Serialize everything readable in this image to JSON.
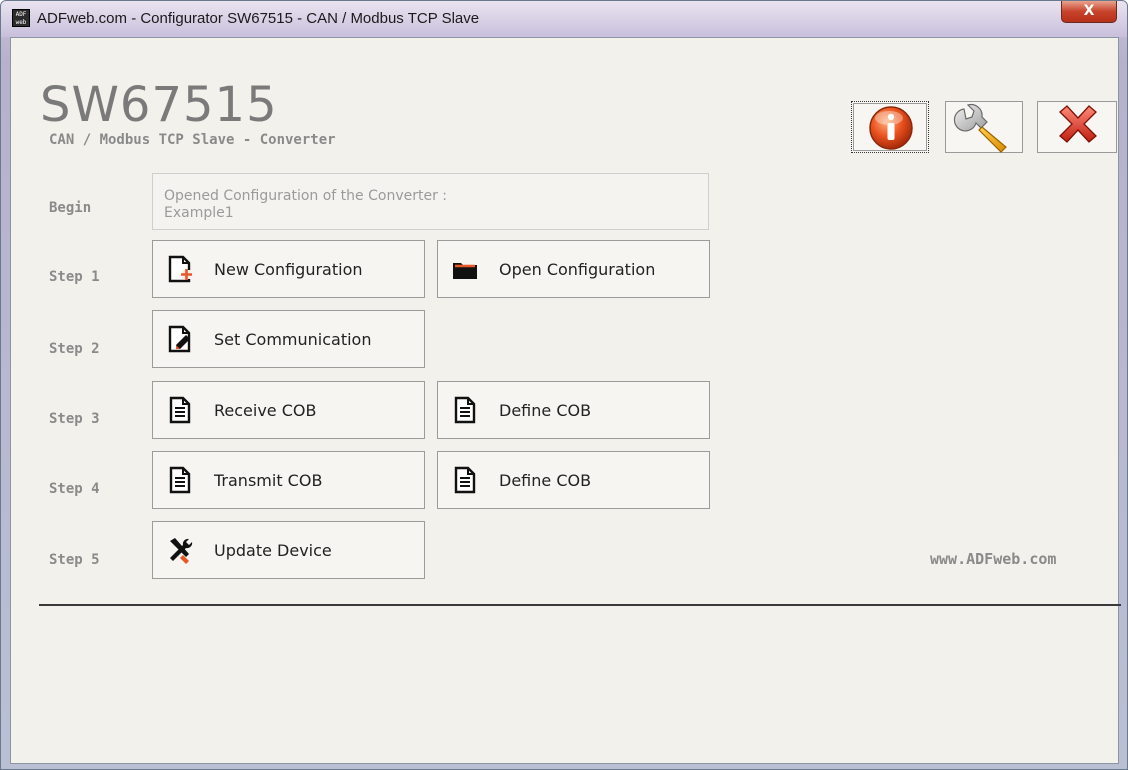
{
  "window": {
    "title": "ADFweb.com - Configurator SW67515 - CAN / Modbus TCP Slave",
    "close_label": "X",
    "app_icon_label": "ADF web"
  },
  "header": {
    "product_code": "SW67515",
    "product_subtitle": "CAN / Modbus TCP Slave - Converter"
  },
  "toolbar": {
    "info_icon": "info-icon",
    "settings_icon": "wrench-icon",
    "exit_icon": "close-x-icon"
  },
  "steps": {
    "begin": {
      "label": "Begin",
      "info_line1": "Opened Configuration of the Converter :",
      "info_line2": "Example1"
    },
    "step1": {
      "label": "Step 1",
      "new_config": "New Configuration",
      "open_config": "Open Configuration"
    },
    "step2": {
      "label": "Step 2",
      "set_comm": "Set Communication"
    },
    "step3": {
      "label": "Step 3",
      "receive_cob": "Receive COB",
      "define_cob": "Define COB"
    },
    "step4": {
      "label": "Step 4",
      "transmit_cob": "Transmit COB",
      "define_cob": "Define COB"
    },
    "step5": {
      "label": "Step 5",
      "update_device": "Update Device"
    }
  },
  "footer": {
    "website": "www.ADFweb.com"
  },
  "colors": {
    "title_gray": "#7a7a7a",
    "label_gray": "#8a8a8a",
    "accent_orange": "#e8572a",
    "close_red": "#c8432a"
  }
}
